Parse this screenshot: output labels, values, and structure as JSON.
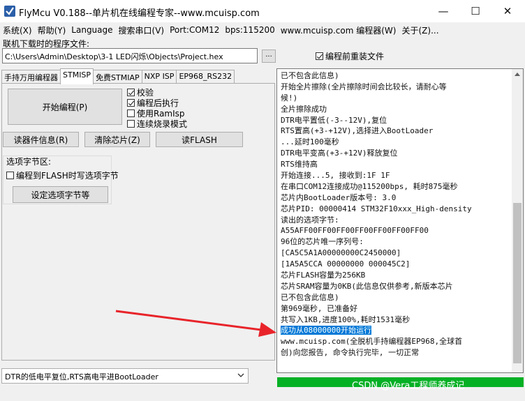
{
  "title": "FlyMcu V0.188--单片机在线编程专家--www.mcuisp.com",
  "window_controls": {
    "minimize": "—",
    "maximize": "☐",
    "close": "✕"
  },
  "menu": [
    "系统(X)",
    "帮助(Y)",
    "Language",
    "搜索串口(V)",
    "Port:COM12",
    "bps:115200",
    "www.mcuisp.com 编程器(W)",
    "关于(Z)..."
  ],
  "file": {
    "label": "联机下载时的程序文件:",
    "path": "C:\\Users\\Admin\\Desktop\\3-1 LED闪烁\\Objects\\Project.hex",
    "browse": "...",
    "reload_label": "编程前重装文件",
    "reload_checked": true
  },
  "tabs": [
    "手持万用编程器",
    "STMISP",
    "免费STMIAP",
    "NXP ISP",
    "EP968_RS232"
  ],
  "active_tab": 1,
  "stmisp": {
    "start_button": "开始编程(P)",
    "options": [
      {
        "label": "校验",
        "checked": true
      },
      {
        "label": "编程后执行",
        "checked": true
      },
      {
        "label": "使用RamIsp",
        "checked": false
      },
      {
        "label": "连续烧录模式",
        "checked": false
      }
    ],
    "read_info_button": "读器件信息(R)",
    "erase_button": "清除芯片(Z)",
    "read_flash_button": "读FLASH",
    "option_bytes_title": "选项字节区:",
    "option_bytes_check": "编程到FLASH时写选项字节",
    "option_bytes_checked": false,
    "set_option_bytes_button": "设定选项字节等"
  },
  "reset_mode": "DTR的低电平复位,RTS高电平进BootLoader",
  "log": [
    "已不包含此信息)",
    "开始全片擦除(全片擦除时间会比较长，请耐心等",
    "候!)",
    "全片擦除成功",
    "DTR电平置低(-3--12V),复位",
    "RTS置高(+3-+12V),选择进入BootLoader",
    "...延时100毫秒",
    "DTR电平变高(+3-+12V)释放复位",
    "RTS维持高",
    "开始连接...5, 接收到:1F 1F",
    "在串口COM12连接成功@115200bps, 耗时875毫秒",
    "芯片内BootLoader版本号: 3.0",
    "芯片PID: 00000414  STM32F10xxx_High-density",
    "读出的选项字节:",
    "A55AFF00FF00FF00FF00FF00FF00FF00",
    "96位的芯片唯一序列号:",
    "[CA5C5A1A00000000C2450000]",
    "[1A5A5CCA 00000000 000045C2]",
    "芯片FLASH容量为256KB",
    "芯片SRAM容量为0KB(此信息仅供参考,新版本芯片",
    "已不包含此信息)",
    "第969毫秒, 已准备好",
    "共写入1KB,进度100%,耗时1531毫秒",
    "成功从08000000开始运行",
    "www.mcuisp.com(全脱机手持编程器EP968,全球首",
    "创)向您报告, 命令执行完毕, 一切正常"
  ],
  "selected_log_line": 23,
  "progress": 1.0,
  "watermark": "CSDN @Vera工程师养成记",
  "colors": {
    "progress": "#06b025",
    "selection": "#0078d7",
    "annotation_arrow": "#e8242a"
  }
}
